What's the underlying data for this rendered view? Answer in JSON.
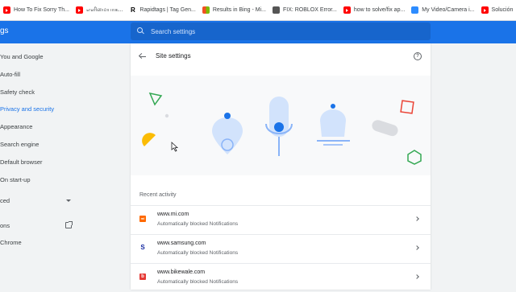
{
  "bookmarks": [
    {
      "icon": "youtube-icon",
      "label": "How To Fix Sorry Th..."
    },
    {
      "icon": "youtube-icon",
      "label": "எளிமையாக..."
    },
    {
      "icon": "rapidtags-icon",
      "label": "Rapidtags | Tag Gen..."
    },
    {
      "icon": "microsoft-icon",
      "label": "Results in Bing - Mi..."
    },
    {
      "icon": "fix-icon",
      "label": "FIX: ROBLOX Error..."
    },
    {
      "icon": "youtube-icon",
      "label": "how to solve/fix ap..."
    },
    {
      "icon": "zoom-icon",
      "label": "My Video/Camera i..."
    },
    {
      "icon": "youtube-icon",
      "label": "Solución"
    }
  ],
  "header": {
    "title": "gs",
    "search_placeholder": "Search settings"
  },
  "sidebar": {
    "items": [
      {
        "label": "You and Google"
      },
      {
        "label": "Auto-fill"
      },
      {
        "label": "Safety check"
      },
      {
        "label": "Privacy and security"
      },
      {
        "label": "Appearance"
      },
      {
        "label": "Search engine"
      },
      {
        "label": "Default browser"
      },
      {
        "label": "On start-up"
      },
      {
        "label": "ced"
      },
      {
        "label": "ons"
      },
      {
        "label": "Chrome"
      }
    ]
  },
  "page": {
    "title": "Site settings",
    "recent_activity": "Recent activity",
    "sites": [
      {
        "name": "www.mi.com",
        "status": "Automatically blocked Notifications",
        "fav_letter": "mi",
        "fav_color": "#ff6900"
      },
      {
        "name": "www.samsung.com",
        "status": "Automatically blocked Notifications",
        "fav_letter": "S",
        "fav_color": "#1428a0"
      },
      {
        "name": "www.bikewale.com",
        "status": "Automatically blocked Notifications",
        "fav_letter": "b",
        "fav_color": "#e53935"
      }
    ]
  },
  "colors": {
    "accent": "#1a73e8",
    "illustration_blue": "#8ab4f8",
    "green": "#34a853",
    "red": "#ea4335",
    "yellow": "#fbbc04"
  }
}
